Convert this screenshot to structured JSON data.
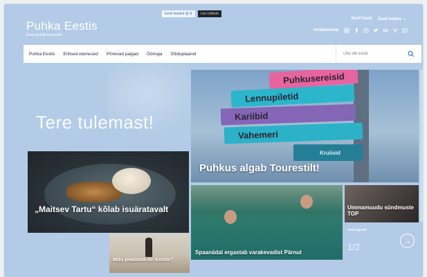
{
  "site": {
    "logo": "Puhka Eestis",
    "tagline": "Eesti ametlik turismiinfo"
  },
  "notice": {
    "text": "Eesti lisaded @ &",
    "button": "Loe rohkem"
  },
  "top_links": [
    "Eesti kaart",
    "Eesti keeles"
  ],
  "social": {
    "hashtag": "#visitestonia",
    "icons": [
      "instagram-icon",
      "facebook-icon",
      "pinterest-icon",
      "twitter-icon",
      "flickr-icon",
      "vimeo-icon",
      "youtube-icon"
    ]
  },
  "nav": {
    "items": [
      "Puhka Eestis",
      "Erilised elamused",
      "Põnevad paigad",
      "Öömaja",
      "Sõiduplaanid"
    ],
    "search_placeholder": "Otsi üle Eesti"
  },
  "hero": {
    "welcome": "Tere tulemast!"
  },
  "tiles": {
    "main": "Puhkus algab Tourestilt!",
    "signs": [
      "Puhkusereisid",
      "Lennupiletid",
      "Kariibid",
      "Vahemeri",
      "Kruiisid"
    ],
    "food": "„Maitsev Tartu“ kõlab isuäratavalt",
    "pool": "Spaanädal ergastab varakevadist Pärnut",
    "concert": "Ummamuudu sündmuste TOP",
    "beach": "Mitu pealinna on Eestis?"
  },
  "pager": {
    "label": "Veel kogusid",
    "position": "1/2"
  },
  "colors": {
    "background": "#b3cbe6",
    "nav_bg": "#ffffff",
    "search_icon": "#2a7bd4"
  }
}
